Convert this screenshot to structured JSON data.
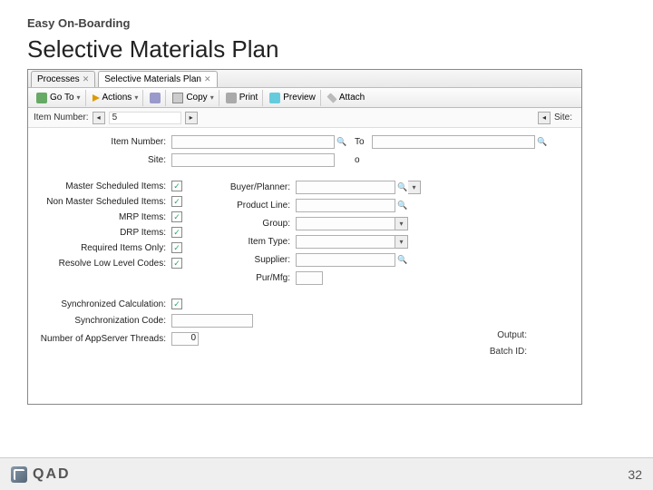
{
  "slide": {
    "eyebrow": "Easy On-Boarding",
    "title": "Selective Materials Plan",
    "page_number": "32",
    "logo_text": "QAD"
  },
  "tabs": [
    {
      "label": "Processes"
    },
    {
      "label": "Selective Materials Plan"
    }
  ],
  "toolbar": {
    "goto": "Go To",
    "actions": "Actions",
    "copy": "Copy",
    "print": "Print",
    "preview": "Preview",
    "attach": "Attach"
  },
  "header": {
    "item_label": "Item Number:",
    "item_value": "5",
    "site_label": "Site:"
  },
  "form": {
    "item_number_label": "Item Number:",
    "to_label": "To",
    "site_label": "Site:",
    "to_label2": "o",
    "left": {
      "master_sched": "Master Scheduled Items:",
      "non_master_sched": "Non Master Scheduled Items:",
      "mrp_items": "MRP Items:",
      "drp_items": "DRP Items:",
      "required_only": "Required Items Only:",
      "resolve_llc": "Resolve Low Level Codes:",
      "sync_calc": "Synchronized Calculation:",
      "sync_code": "Synchronization Code:",
      "num_threads": "Number of AppServer Threads:",
      "threads_val": "0"
    },
    "right": {
      "buyer": "Buyer/Planner:",
      "product_line": "Product Line:",
      "group": "Group:",
      "item_type": "Item Type:",
      "supplier": "Supplier:",
      "purmfg": "Pur/Mfg:"
    },
    "output_label": "Output:",
    "batch_label": "Batch ID:"
  }
}
